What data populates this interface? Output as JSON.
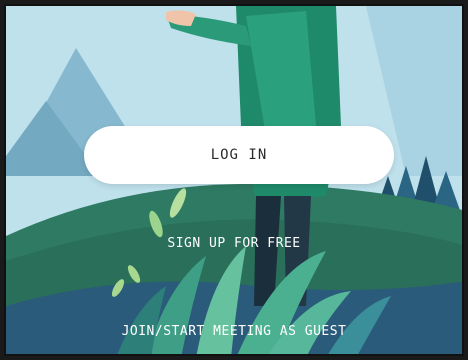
{
  "auth": {
    "login_label": "LOG IN",
    "signup_label": "SIGN UP FOR FREE",
    "guest_label": "JOIN/START MEETING AS GUEST"
  }
}
